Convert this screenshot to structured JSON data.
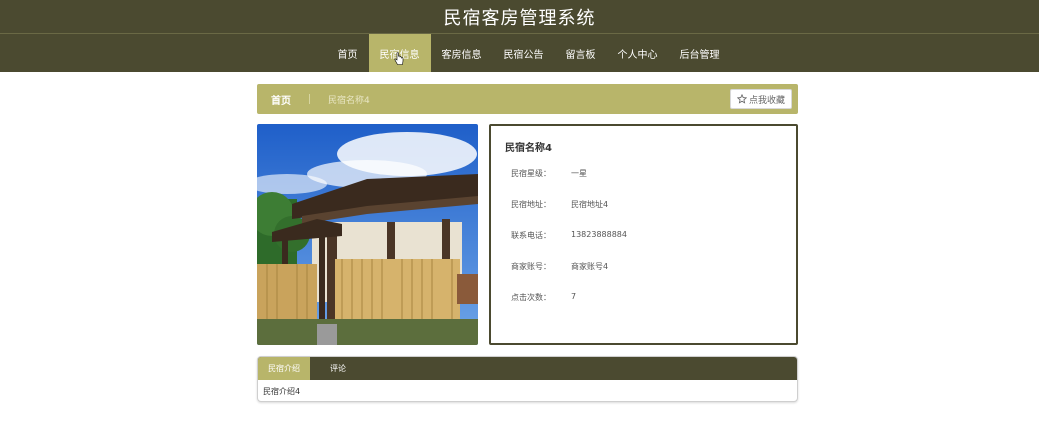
{
  "header": {
    "title": "民宿客房管理系统"
  },
  "nav": {
    "items": [
      {
        "label": "首页",
        "active": false
      },
      {
        "label": "民宿信息",
        "active": true
      },
      {
        "label": "客房信息",
        "active": false
      },
      {
        "label": "民宿公告",
        "active": false
      },
      {
        "label": "留言板",
        "active": false
      },
      {
        "label": "个人中心",
        "active": false
      },
      {
        "label": "后台管理",
        "active": false
      }
    ]
  },
  "breadcrumb": {
    "home": "首页",
    "current": "民宿名称4"
  },
  "favorite": {
    "label": "点我收藏",
    "icon": "star-outline-icon"
  },
  "detail": {
    "name": "民宿名称4",
    "rows": [
      {
        "label": "民宿星级：",
        "value": "一星"
      },
      {
        "label": "民宿地址：",
        "value": "民宿地址4"
      },
      {
        "label": "联系电话：",
        "value": "13823888884"
      },
      {
        "label": "商家账号：",
        "value": "商家账号4"
      },
      {
        "label": "点击次数：",
        "value": "7"
      }
    ]
  },
  "tabs": {
    "items": [
      {
        "label": "民宿介绍",
        "active": true
      },
      {
        "label": "评论",
        "active": false
      }
    ],
    "content": "民宿介绍4"
  },
  "colors": {
    "dark": "#4b4a30",
    "accent": "#b8b56a"
  }
}
